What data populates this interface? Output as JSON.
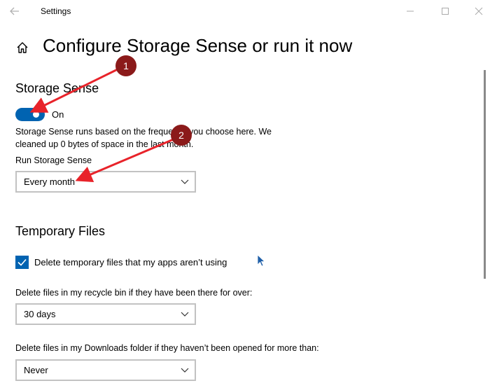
{
  "window": {
    "title": "Settings"
  },
  "page": {
    "title": "Configure Storage Sense or run it now"
  },
  "storage_sense": {
    "heading": "Storage Sense",
    "toggle_state": "On",
    "description": "Storage Sense runs based on the frequency you choose here. We cleaned up 0 bytes of space in the last month.",
    "run_label": "Run Storage Sense",
    "run_value": "Every month"
  },
  "temporary_files": {
    "heading": "Temporary Files",
    "delete_temp_label": "Delete temporary files that my apps aren’t using",
    "recycle_label": "Delete files in my recycle bin if they have been there for over:",
    "recycle_value": "30 days",
    "downloads_label": "Delete files in my Downloads folder if they haven’t been opened for more than:",
    "downloads_value": "Never"
  },
  "annotations": {
    "badge1": "1",
    "badge2": "2"
  },
  "colors": {
    "accent": "#0063b1",
    "annotation": "#e8232a",
    "badge": "#8b1a1a"
  }
}
